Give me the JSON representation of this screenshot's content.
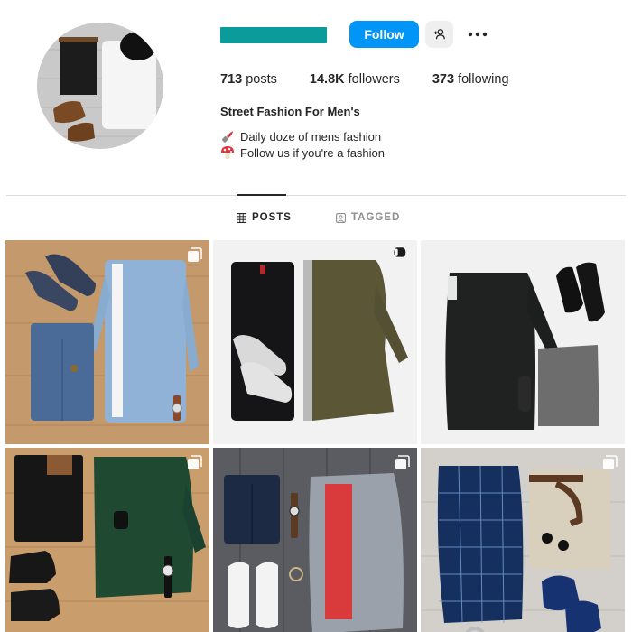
{
  "profile": {
    "username_bar_color": "#0b9b9b",
    "follow_label": "Follow",
    "follow_color": "#0095f6",
    "stats": [
      {
        "value": "713",
        "label": "posts"
      },
      {
        "value": "14.8K",
        "label": "followers"
      },
      {
        "value": "373",
        "label": "following"
      }
    ],
    "bio_name": "Street Fashion For Men's",
    "bio_lines": [
      {
        "icon": "lipstick-icon",
        "text": "Daily doze of mens fashion"
      },
      {
        "icon": "mushroom-icon",
        "text": "Follow us if you're a fashion"
      }
    ]
  },
  "tabs": {
    "posts_label": "POSTS",
    "tagged_label": "TAGGED",
    "active": "posts"
  },
  "posts": [
    {
      "icon": "carousel-icon",
      "description": "Flat lay: navy sneakers, light denim shirt, blue jeans, watch on wood floor"
    },
    {
      "icon": "reel-icon",
      "description": "Flat lay: black jeans, olive jacket, white sneakers on white"
    },
    {
      "icon": "none",
      "description": "Flat lay: black jacket, black boots, grey chinos, belt on white"
    },
    {
      "icon": "carousel-icon",
      "description": "Flat lay: black jeans, green shirt, chelsea boots, sunglasses, watch on wood"
    },
    {
      "icon": "carousel-icon",
      "description": "Flat lay: dark jeans, grey overshirt, red tee, white sneakers on grey wood"
    },
    {
      "icon": "carousel-icon",
      "description": "Flat lay: navy plaid shirt, khaki chinos, navy loafers, belt on wood"
    }
  ]
}
